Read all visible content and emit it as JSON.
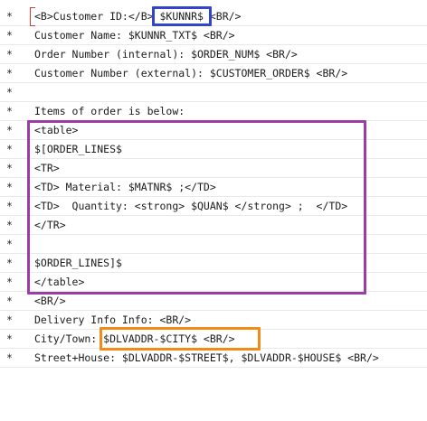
{
  "editor": {
    "gutter_marker": "*",
    "lines": [
      "<B>Customer ID:</B> $KUNNR$ <BR/>",
      "Customer Name: $KUNNR_TXT$ <BR/>",
      "Order Number (internal): $ORDER_NUM$ <BR/>",
      "Customer Number (external): $CUSTOMER_ORDER$ <BR/>",
      "",
      "Items of order is below:",
      "<table>",
      "$[ORDER_LINES$",
      "<TR>",
      "<TD> Material: $MATNR$ ;</TD>",
      "<TD>  Quantity: <strong> $QUAN$ </strong> ;  </TD>",
      "</TR>",
      "",
      "$ORDER_LINES]$",
      "</table>",
      "<BR/>",
      "Delivery Info Info: <BR/>",
      "City/Town: $DLVADDR-$CITY$ <BR/>",
      "Street+House: $DLVADDR-$STREET$, $DLVADDR-$HOUSE$ <BR/>"
    ]
  },
  "highlights": {
    "blue": {
      "label": "$KUNNR$",
      "color": "#3344cc"
    },
    "purple": {
      "label": "order-lines block",
      "color": "#9b3da6"
    },
    "orange": {
      "label": "$DLVADDR-$CITY$ <BR/>",
      "color": "#f28a18"
    }
  }
}
